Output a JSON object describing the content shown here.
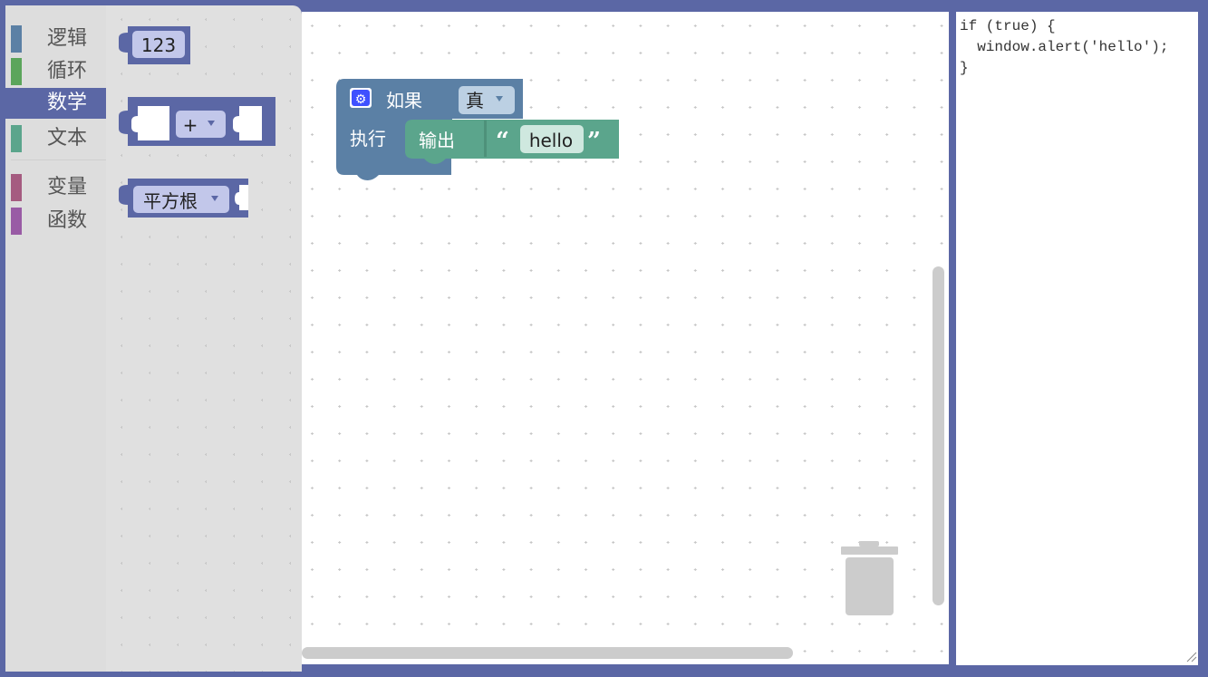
{
  "toolbox": {
    "categories": [
      {
        "label": "逻辑",
        "color": "#5b80a5",
        "selected": false
      },
      {
        "label": "循环",
        "color": "#5ba55b",
        "selected": false
      },
      {
        "label": "数学",
        "color": "#5b67a5",
        "selected": true
      },
      {
        "label": "文本",
        "color": "#5ba58c",
        "selected": false
      },
      {
        "label": "变量",
        "color": "#a55b80",
        "selected": false
      },
      {
        "label": "函数",
        "color": "#995ba5",
        "selected": false
      }
    ]
  },
  "flyout": {
    "number_block": {
      "value": "123"
    },
    "arithmetic_block": {
      "operator": "+"
    },
    "single_block": {
      "operation": "平方根"
    }
  },
  "workspace": {
    "if_block": {
      "if_label": "如果",
      "do_label": "执行",
      "condition_value": "真"
    },
    "print_block": {
      "label": "输出",
      "text_value": "hello",
      "open_quote": "“",
      "close_quote": "”"
    }
  },
  "code": {
    "lines": [
      "if (true) {",
      "  window.alert('hello');",
      "}"
    ]
  },
  "colors": {
    "frame": "#5b67a5",
    "logic": "#5b80a5",
    "math": "#5b67a5",
    "text": "#5ba58c",
    "toolbox_bg": "#dddddd",
    "flyout_bg": "#e0e0e0",
    "scrollbar": "#cccccc"
  },
  "icons": {
    "mutator": "gear-icon",
    "dropdown": "dropdown-arrow-icon",
    "trash": "trash-icon",
    "resize": "resize-grip-icon"
  }
}
